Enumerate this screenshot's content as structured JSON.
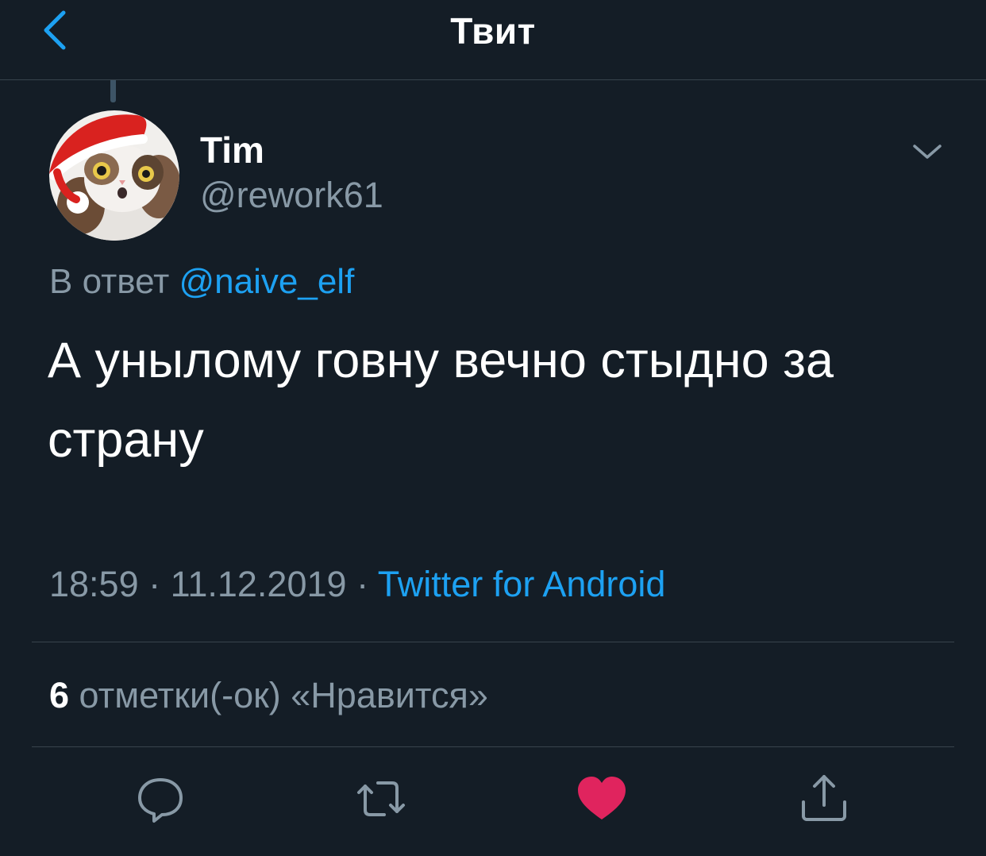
{
  "header": {
    "title": "Твит",
    "back_icon": "chevron-left-icon"
  },
  "tweet": {
    "author": {
      "display_name": "Tim",
      "username": "@rework61",
      "avatar": "cat-in-santa-hat-avatar"
    },
    "reply_prefix": "В ответ",
    "reply_to": "@naive_elf",
    "text": "А унылому говну вечно стыдно за страну",
    "time": "18:59",
    "date": "11.12.2019",
    "separator": "·",
    "source": "Twitter for Android",
    "likes_count": "6",
    "likes_label": "отметки(-ок) «Нравится»",
    "liked": true
  },
  "actions": [
    {
      "name": "reply",
      "icon": "comment-icon"
    },
    {
      "name": "retweet",
      "icon": "retweet-icon"
    },
    {
      "name": "like",
      "icon": "heart-icon",
      "active": true
    },
    {
      "name": "share",
      "icon": "share-icon"
    }
  ],
  "colors": {
    "background": "#141d26",
    "accent": "#1da1f2",
    "secondary_text": "#8899a6",
    "divider": "#38444d",
    "like": "#e0245e"
  }
}
